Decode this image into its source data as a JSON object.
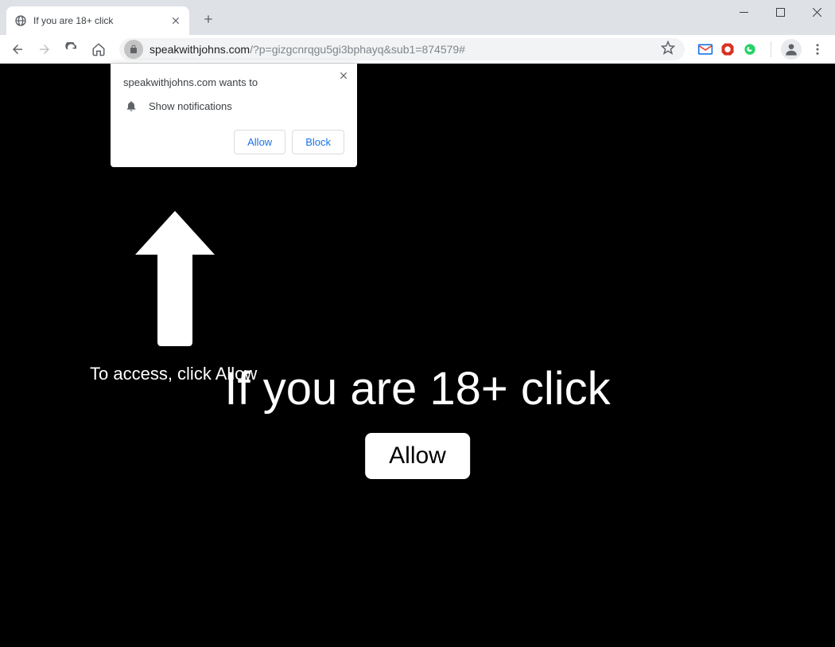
{
  "window": {
    "tab_title": "If you are 18+ click"
  },
  "toolbar": {
    "url_domain": "speakwithjohns.com",
    "url_path": "/?p=gizgcnrqgu5gi3bphayq&sub1=874579#"
  },
  "permission": {
    "title": "speakwithjohns.com wants to",
    "item": "Show notifications",
    "allow": "Allow",
    "block": "Block"
  },
  "page": {
    "access_text": "To access, click Allow",
    "heading": "If you are 18+ click",
    "allow_button": "Allow"
  }
}
